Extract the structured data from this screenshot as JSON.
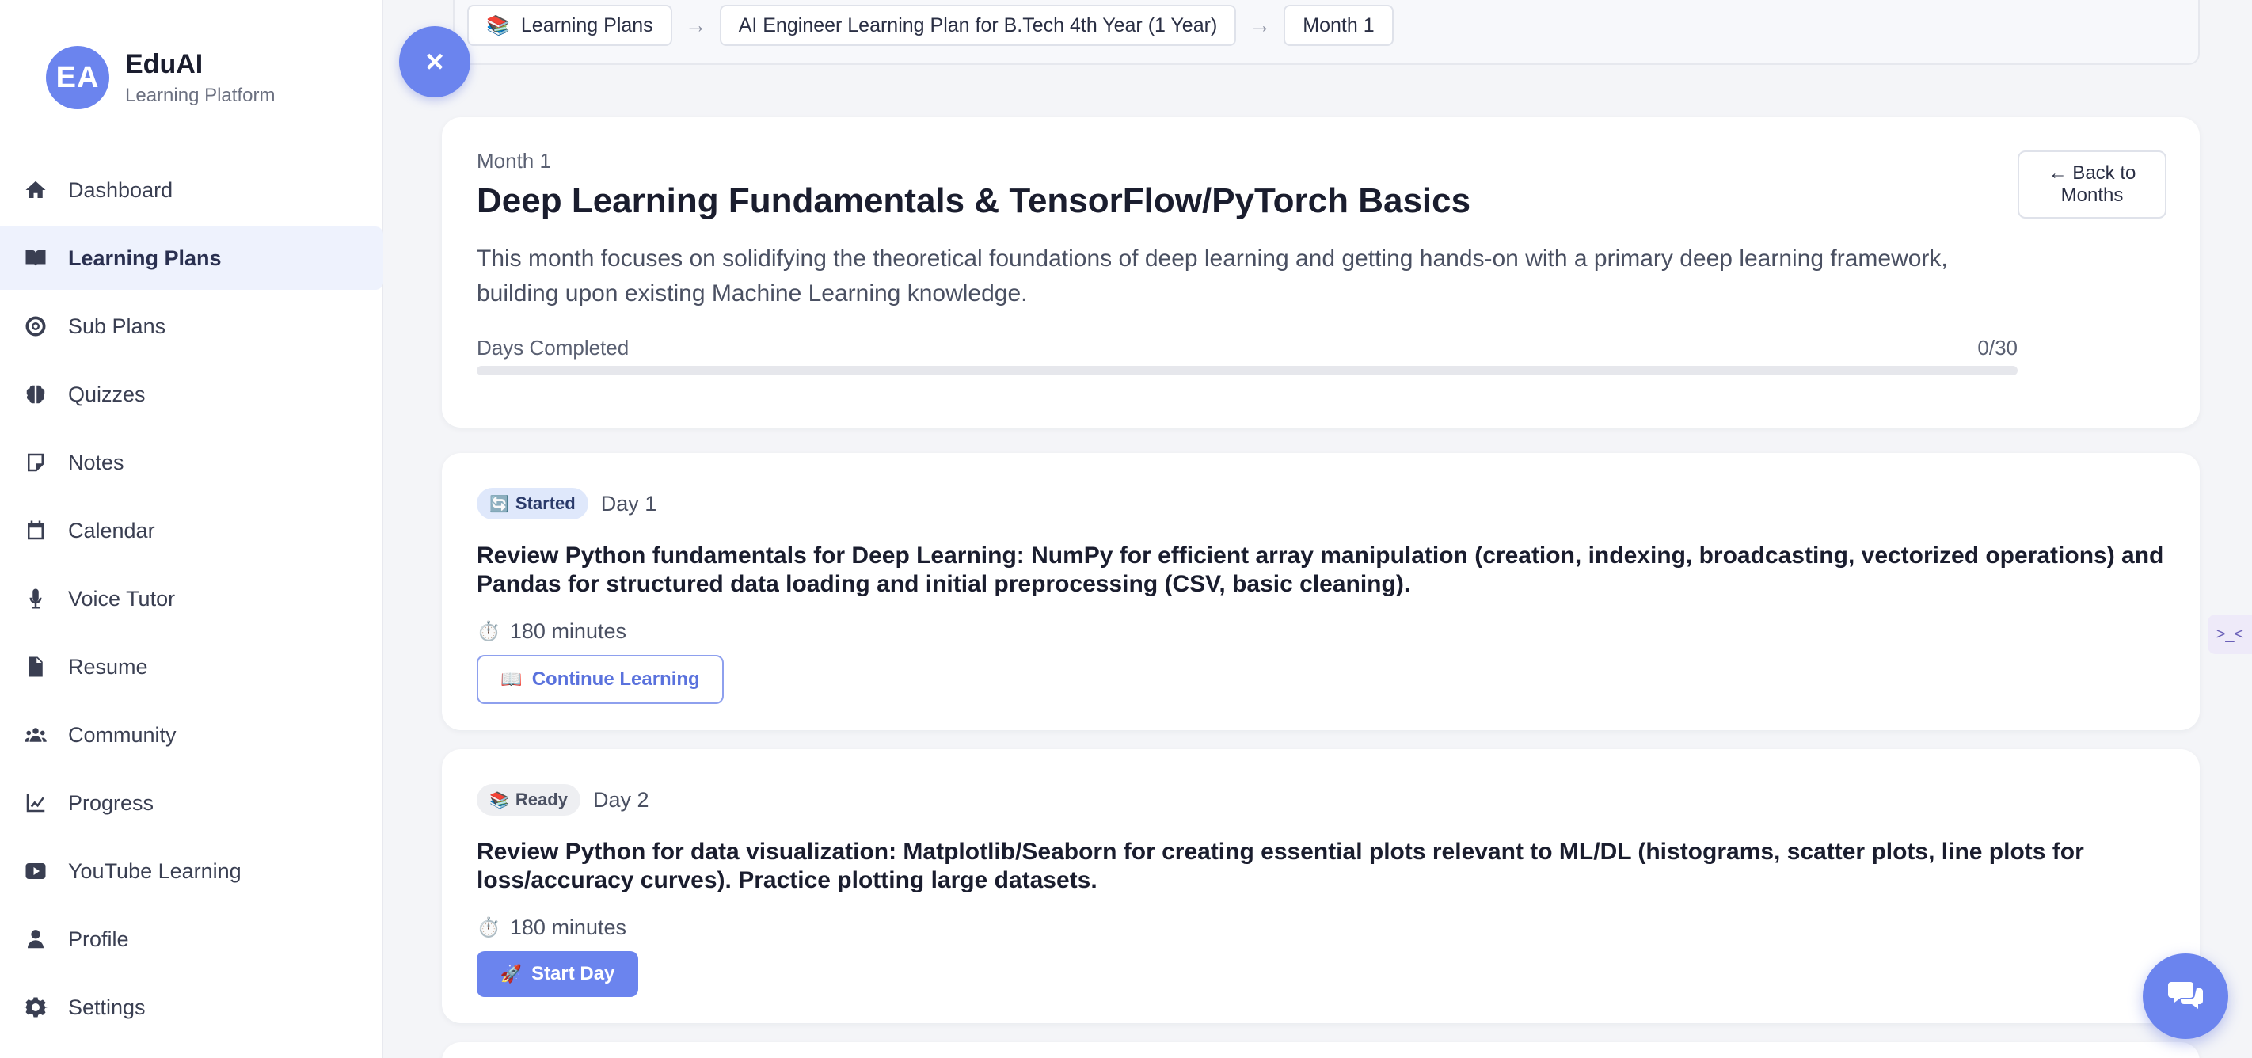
{
  "brand": {
    "initials": "EA",
    "name": "EduAI",
    "subtitle": "Learning Platform"
  },
  "sidebar": {
    "items": [
      {
        "label": "Dashboard",
        "icon": "home-icon",
        "active": false
      },
      {
        "label": "Learning Plans",
        "icon": "book-open-icon",
        "active": true
      },
      {
        "label": "Sub Plans",
        "icon": "target-icon",
        "active": false
      },
      {
        "label": "Quizzes",
        "icon": "brain-icon",
        "active": false
      },
      {
        "label": "Notes",
        "icon": "sticky-note-icon",
        "active": false
      },
      {
        "label": "Calendar",
        "icon": "calendar-icon",
        "active": false
      },
      {
        "label": "Voice Tutor",
        "icon": "microphone-icon",
        "active": false
      },
      {
        "label": "Resume",
        "icon": "file-icon",
        "active": false
      },
      {
        "label": "Community",
        "icon": "users-icon",
        "active": false
      },
      {
        "label": "Progress",
        "icon": "chart-line-icon",
        "active": false
      },
      {
        "label": "YouTube Learning",
        "icon": "youtube-icon",
        "active": false
      },
      {
        "label": "Profile",
        "icon": "user-icon",
        "active": false
      },
      {
        "label": "Settings",
        "icon": "gear-icon",
        "active": false
      }
    ]
  },
  "close_button": {
    "symbol": "×"
  },
  "breadcrumb": {
    "items": [
      {
        "label": "Learning Plans",
        "icon": "📚"
      },
      {
        "label": "AI Engineer Learning Plan for B.Tech 4th Year (1 Year)"
      },
      {
        "label": "Month 1"
      }
    ],
    "separator": "→"
  },
  "month": {
    "label": "Month 1",
    "title": "Deep Learning Fundamentals & TensorFlow/PyTorch Basics",
    "description": "This month focuses on solidifying the theoretical foundations of deep learning and getting hands-on with a primary deep learning framework, building upon existing Machine Learning knowledge.",
    "back_label": "← Back to Months",
    "progress_label": "Days Completed",
    "progress_text": "0/30",
    "progress_fraction": 0
  },
  "days": [
    {
      "status": "Started",
      "status_icon": "🔄",
      "day_label": "Day 1",
      "title": "Review Python fundamentals for Deep Learning: NumPy for efficient array manipulation (creation, indexing, broadcasting, vectorized operations) and Pandas for structured data loading and initial preprocessing (CSV, basic cleaning).",
      "duration_icon": "⏱️",
      "duration": "180 minutes",
      "action_icon": "📖",
      "action_label": "Continue Learning"
    },
    {
      "status": "Ready",
      "status_icon": "📚",
      "day_label": "Day 2",
      "title": "Review Python for data visualization: Matplotlib/Seaborn for creating essential plots relevant to ML/DL (histograms, scatter plots, line plots for loss/accuracy curves). Practice plotting large datasets.",
      "duration_icon": "⏱️",
      "duration": "180 minutes",
      "action_icon": "🚀",
      "action_label": "Start Day"
    }
  ],
  "edge_widget": {
    "text": ">_<"
  },
  "colors": {
    "accent": "#6b84ee",
    "active_bg": "#eef2fd",
    "badge_started": "#dfe8fb",
    "badge_ready": "#eeeff2"
  }
}
